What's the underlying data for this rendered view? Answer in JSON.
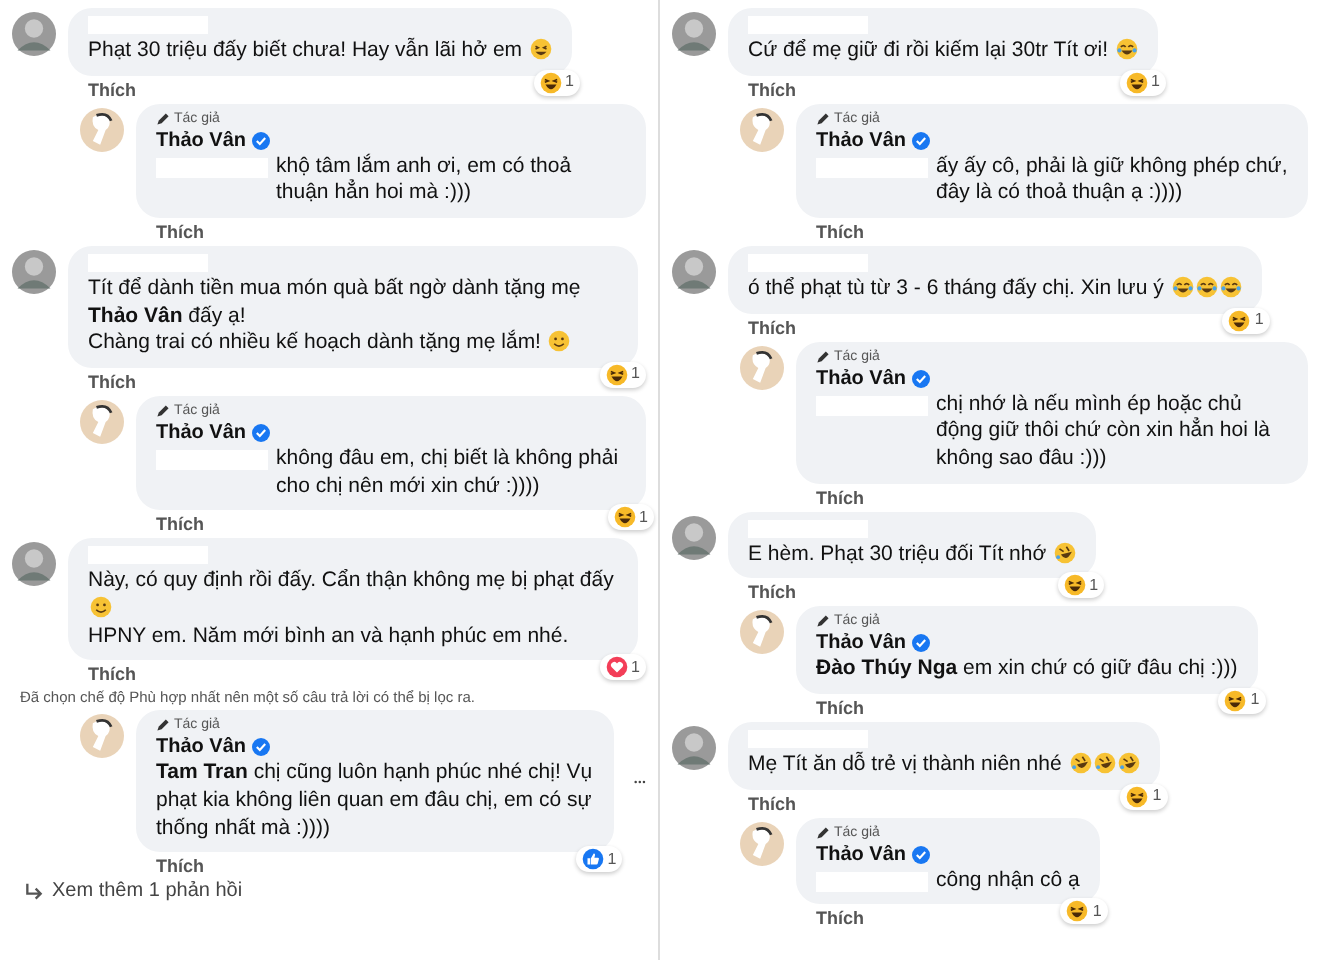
{
  "columns": [
    {
      "items": [
        {
          "kind": "comment",
          "lines": [
            {
              "text": "Phạt 30 triệu đấy biết chưa! Hay vẫn lãi hở em",
              "emojis": [
                {
                  "kind": "grin"
                }
              ]
            }
          ],
          "reaction": {
            "kind": "haha",
            "count": "1"
          },
          "like_label": "Thích"
        },
        {
          "kind": "reply",
          "badge": "Tác giả",
          "author": "Thảo Vân",
          "mention_hidden": true,
          "lines": [
            {
              "text": "khộ tâm lắm anh ơi, em có thoả thuận hẳn hoi mà :)))"
            }
          ],
          "like_label": "Thích"
        },
        {
          "kind": "comment",
          "lines": [
            {
              "text": "Tít để dành tiền mua món quà bất ngờ dành tặng mẹ **Thảo Vân** đấy ạ!"
            },
            {
              "text": "Chàng trai có nhiều kế hoạch dành tặng mẹ lắm!",
              "emojis": [
                {
                  "kind": "smile"
                }
              ]
            }
          ],
          "reaction": {
            "kind": "haha",
            "count": "1"
          },
          "like_label": "Thích"
        },
        {
          "kind": "reply",
          "badge": "Tác giả",
          "author": "Thảo Vân",
          "mention_hidden": true,
          "lines": [
            {
              "text": "không đâu em, chị biết là không phải cho chị nên mới xin chứ :))))"
            }
          ],
          "reaction": {
            "kind": "haha",
            "count": "1"
          },
          "like_label": "Thích"
        },
        {
          "kind": "comment",
          "lines": [
            {
              "text": "Này, có quy định rồi đấy. Cẩn thận không mẹ bị phạt đấy",
              "emojis": [
                {
                  "kind": "smile"
                }
              ]
            },
            {
              "text": "HPNY em. Năm mới bình an và hạnh phúc em nhé."
            }
          ],
          "reaction": {
            "kind": "love",
            "count": "1"
          },
          "like_label": "Thích"
        },
        {
          "kind": "note",
          "text": "Đã chọn chế độ Phù hợp nhất nên một số câu trả lời có thể bị lọc ra."
        },
        {
          "kind": "reply",
          "badge": "Tác giả",
          "author": "Thảo Vân",
          "mention_hidden": false,
          "has_menu": true,
          "lines": [
            {
              "text": "**Tam Tran** chị cũng luôn hạnh phúc nhé chị! Vụ phạt kia không liên quan em đâu chị, em có sự thống nhất mà :))))"
            }
          ],
          "reaction": {
            "kind": "like",
            "count": "1"
          },
          "like_label": "Thích"
        },
        {
          "kind": "more",
          "text": "Xem thêm 1 phản hồi"
        }
      ]
    },
    {
      "items": [
        {
          "kind": "comment",
          "lines": [
            {
              "text": "Cứ để mẹ giữ đi rồi kiếm lại 30tr Tít ơi!",
              "emojis": [
                {
                  "kind": "joy"
                }
              ]
            }
          ],
          "reaction": {
            "kind": "haha",
            "count": "1"
          },
          "like_label": "Thích"
        },
        {
          "kind": "reply",
          "badge": "Tác giả",
          "author": "Thảo Vân",
          "mention_hidden": true,
          "lines": [
            {
              "text": "ấy ấy cô, phải là giữ không phép chứ, đây là có thoả thuận ạ :))))"
            }
          ],
          "like_label": "Thích"
        },
        {
          "kind": "comment",
          "lines": [
            {
              "text": "ó thể phạt tù từ 3 - 6 tháng đấy chị. Xin lưu ý",
              "emojis": [
                {
                  "kind": "joy"
                },
                {
                  "kind": "joy"
                },
                {
                  "kind": "joy"
                }
              ]
            }
          ],
          "reaction": {
            "kind": "haha",
            "count": "1"
          },
          "like_label": "Thích"
        },
        {
          "kind": "reply",
          "badge": "Tác giả",
          "author": "Thảo Vân",
          "mention_hidden": true,
          "lines": [
            {
              "text": "chị nhớ là nếu mình ép hoặc chủ động giữ thôi chứ còn xin hẳn hoi là không sao đâu :)))"
            }
          ],
          "like_label": "Thích"
        },
        {
          "kind": "comment",
          "lines": [
            {
              "text": "E hèm. Phạt 30 triệu đối Tít nhớ",
              "emojis": [
                {
                  "kind": "rofl"
                }
              ]
            }
          ],
          "reaction": {
            "kind": "haha",
            "count": "1"
          },
          "like_label": "Thích"
        },
        {
          "kind": "reply",
          "badge": "Tác giả",
          "author": "Thảo Vân",
          "mention_hidden": false,
          "lines": [
            {
              "text": "**Đào Thúy Nga** em xin chứ có giữ đâu chị :)))"
            }
          ],
          "reaction": {
            "kind": "haha",
            "count": "1"
          },
          "like_label": "Thích"
        },
        {
          "kind": "comment",
          "lines": [
            {
              "text": "Mẹ Tít ăn dỗ trẻ vị thành niên nhé",
              "emojis": [
                {
                  "kind": "rofl"
                },
                {
                  "kind": "rofl"
                },
                {
                  "kind": "rofl"
                }
              ]
            }
          ],
          "reaction": {
            "kind": "haha",
            "count": "1"
          },
          "like_label": "Thích"
        },
        {
          "kind": "reply",
          "badge": "Tác giả",
          "author": "Thảo Vân",
          "mention_hidden": true,
          "lines": [
            {
              "text": "công nhận cô ạ"
            }
          ],
          "reaction": {
            "kind": "haha",
            "count": "1"
          },
          "like_label": "Thích"
        }
      ]
    }
  ]
}
